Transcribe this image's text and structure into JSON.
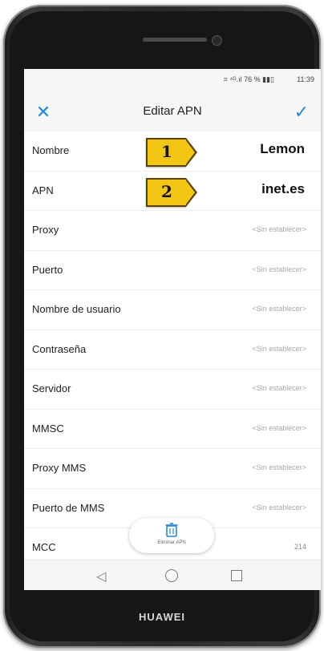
{
  "device": {
    "brand": "HUAWEI"
  },
  "status_bar": {
    "icons": "⌗ ⁴ᴳ.ıl 76 % ▮▮▯",
    "time": "11:39"
  },
  "app_bar": {
    "title": "Editar APN",
    "close_icon": "close-icon",
    "confirm_icon": "check-icon"
  },
  "callouts": [
    "1",
    "2"
  ],
  "fields": [
    {
      "label": "Nombre",
      "value": "Lemon"
    },
    {
      "label": "APN",
      "value": "inet.es"
    },
    {
      "label": "Proxy",
      "value": "<Sin establecer>"
    },
    {
      "label": "Puerto",
      "value": "<Sin establecer>"
    },
    {
      "label": "Nombre de usuario",
      "value": "<Sin establecer>"
    },
    {
      "label": "Contraseña",
      "value": "<Sin establecer>"
    },
    {
      "label": "Servidor",
      "value": "<Sin establecer>"
    },
    {
      "label": "MMSC",
      "value": "<Sin establecer>"
    },
    {
      "label": "Proxy MMS",
      "value": "<Sin establecer>"
    },
    {
      "label": "Puerto de MMS",
      "value": "<Sin establecer>"
    },
    {
      "label": "MCC",
      "value": "214"
    }
  ],
  "fab": {
    "label": "Eliminar APN",
    "icon": "trash-icon"
  },
  "nav_bar": {
    "back_icon": "back-icon",
    "home_icon": "home-icon",
    "recents_icon": "recents-icon"
  },
  "colors": {
    "accent": "#1e88e5",
    "callout": "#f4c614"
  }
}
